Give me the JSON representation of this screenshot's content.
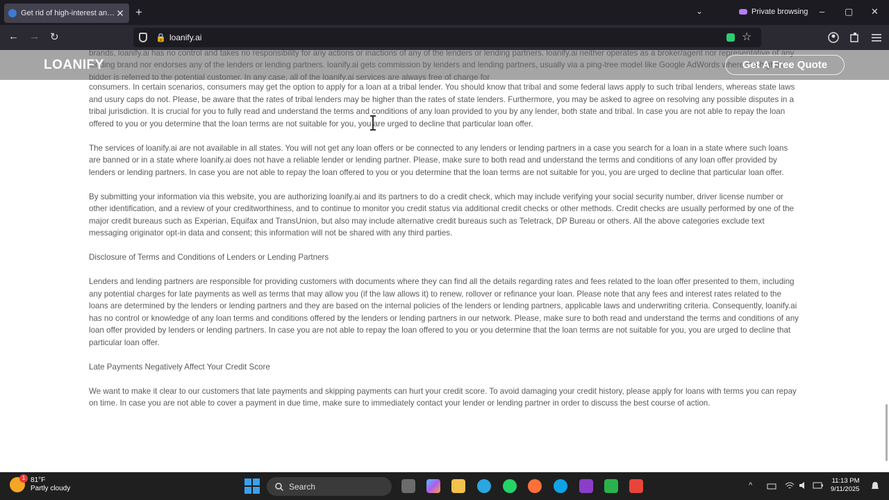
{
  "browser": {
    "tab_title": "Get rid of high-interest and hig",
    "tab_close": "✕",
    "new_tab": "+",
    "tab_list": "⌄",
    "private_label": "Private browsing",
    "win_min": "–",
    "win_max": "▢",
    "win_close": "✕",
    "back": "←",
    "forward": "→",
    "reload": "↻",
    "url": "loanify.ai",
    "lock": "🔒",
    "star": "☆"
  },
  "site": {
    "logo": "LOANIFY",
    "cta": "Get A Free Quote",
    "header_overlap_text": "brands, loanify.ai has no control and takes no responsibility for any actions or inactions of any of the lenders or lending partners. loanify.ai neither operates as a broker/agent nor representative of any lending brand nor endorses any of the lenders or lending partners. loanify.ai gets commission by lenders and lending partners, usually via a ping-tree model like Google AdWords where the highest bidder is referred to the potential customer. In any case, all of the loanify.ai services are always free of charge for"
  },
  "content": {
    "p1": "consumers. In certain scenarios, consumers may get the option to apply for a loan at a tribal lender. You should know that tribal and some federal laws apply to such tribal lenders, whereas state laws and usury caps do not. Please, be aware that the rates of tribal lenders may be higher than the rates of state lenders. Furthermore, you may be asked to agree on resolving any possible disputes in a tribal jurisdiction. It is crucial for you to fully read and understand the terms and conditions of any loan provided to you by any lender, both state and tribal. In case you are not able to repay the loan offered to you or you determine that the loan terms are not suitable for you, you are urged to decline that particular loan offer.",
    "p2": "The services of loanify.ai are not available in all states. You will not get any loan offers or be connected to any lenders or lending partners in a case you search for a loan in a state where such loans are banned or in a state where loanify.ai does not have a reliable lender or lending partner. Please, make sure to both read and understand the terms and conditions of any loan offer provided by lenders or lending partners. In case you are not able to repay the loan offered to you or you determine that the loan terms are not suitable for you, you are urged to decline that particular loan offer.",
    "p3": "By submitting your information via this website, you are authorizing loanify.ai and its partners to do a credit check, which may include verifying your social security number, driver license number or other identification, and a review of your creditworthiness, and to continue to monitor you credit status via additional credit checks or other methods. Credit checks are usually performed by one of the major credit bureaus such as Experian, Equifax and TransUnion, but also may include alternative credit bureaus such as Teletrack, DP Bureau or others. All the above categories exclude text messaging originator opt-in data and consent; this information will not be shared with any third parties.",
    "h1": "Disclosure of Terms and Conditions of Lenders or Lending Partners",
    "p4": "Lenders and lending partners are responsible for providing customers with documents where they can find all the details regarding rates and fees related to the loan offer presented to them, including any potential charges for late payments as well as terms that may allow you (if the law allows it) to renew, rollover or refinance your loan. Please note that any fees and interest rates related to the loans are determined by the lenders or lending partners and they are based on the internal policies of the lenders or lending partners, applicable laws and underwriting criteria. Consequently, loanify.ai has no control or knowledge of any loan terms and conditions offered by the lenders or lending partners in our network. Please, make sure to both read and understand the terms and conditions of any loan offer provided by lenders or lending partners. In case you are not able to repay the loan offered to you or you determine that the loan terms are not suitable for you, you are urged to decline that particular loan offer.",
    "h2": "Late Payments Negatively Affect Your Credit Score",
    "p5": "We want to make it clear to our customers that late payments and skipping payments can hurt your credit score. To avoid damaging your credit history, please apply for loans with terms you can repay on time. In case you are not able to cover a payment in due time, make sure to immediately contact your lender or lending partner in order to discuss the best course of action."
  },
  "taskbar": {
    "temp": "81°F",
    "weather": "Partly cloudy",
    "search_label": "Search",
    "time": "11:13 PM",
    "date": "9/11/2025",
    "tray_chevron": "^"
  },
  "colors": {
    "accent_purple": "#b67cf4",
    "header_gray": "#8c8c8c",
    "body_text": "#5a5a5a"
  }
}
